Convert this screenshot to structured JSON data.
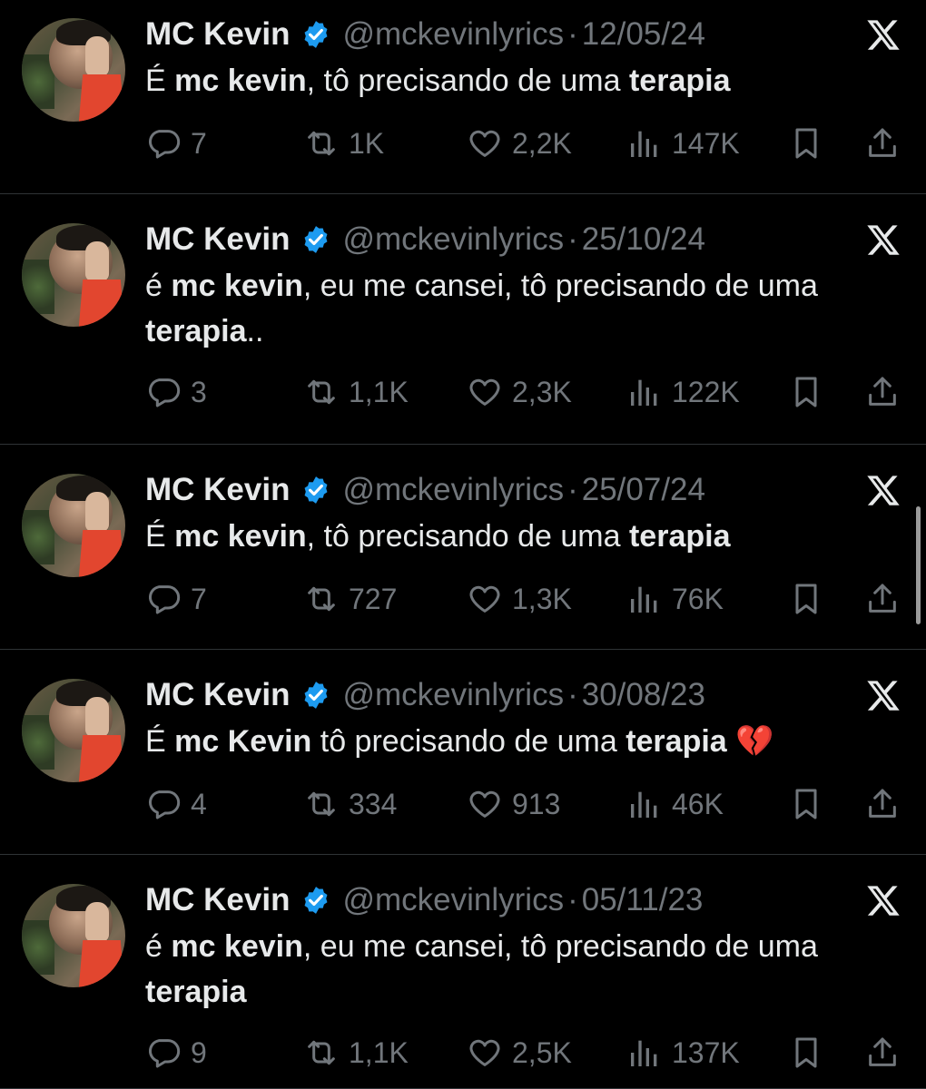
{
  "colors": {
    "background": "#000000",
    "text": "#e7e9ea",
    "muted": "#71767b",
    "verified": "#1d9bf0",
    "divider": "#2f3336"
  },
  "tweets": [
    {
      "name": "MC Kevin",
      "handle": "@mckevinlyrics",
      "separator": "·",
      "date": "12/05/24",
      "text": [
        {
          "t": "É "
        },
        {
          "t": "mc kevin",
          "b": true
        },
        {
          "t": ", tô precisando de uma "
        },
        {
          "t": "terapia",
          "b": true
        }
      ],
      "replies": "7",
      "retweets": "1K",
      "likes": "2,2K",
      "views": "147K"
    },
    {
      "name": "MC Kevin",
      "handle": "@mckevinlyrics",
      "separator": "·",
      "date": "25/10/24",
      "text": [
        {
          "t": "é "
        },
        {
          "t": "mc kevin",
          "b": true
        },
        {
          "t": ", eu me cansei, tô precisando de uma "
        },
        {
          "t": "terapia",
          "b": true
        },
        {
          "t": ".."
        }
      ],
      "replies": "3",
      "retweets": "1,1K",
      "likes": "2,3K",
      "views": "122K"
    },
    {
      "name": "MC Kevin",
      "handle": "@mckevinlyrics",
      "separator": "·",
      "date": "25/07/24",
      "text": [
        {
          "t": "É "
        },
        {
          "t": "mc kevin",
          "b": true
        },
        {
          "t": ", tô precisando de uma "
        },
        {
          "t": "terapia",
          "b": true
        }
      ],
      "replies": "7",
      "retweets": "727",
      "likes": "1,3K",
      "views": "76K"
    },
    {
      "name": "MC Kevin",
      "handle": "@mckevinlyrics",
      "separator": "·",
      "date": "30/08/23",
      "text": [
        {
          "t": "É "
        },
        {
          "t": "mc Kevin",
          "b": true
        },
        {
          "t": " tô precisando de uma "
        },
        {
          "t": "terapia",
          "b": true
        },
        {
          "t": " 💔"
        }
      ],
      "replies": "4",
      "retweets": "334",
      "likes": "913",
      "views": "46K"
    },
    {
      "name": "MC Kevin",
      "handle": "@mckevinlyrics",
      "separator": "·",
      "date": "05/11/23",
      "text": [
        {
          "t": "é "
        },
        {
          "t": "mc kevin",
          "b": true
        },
        {
          "t": ", eu me cansei, tô precisando de uma "
        },
        {
          "t": "terapia",
          "b": true
        }
      ],
      "replies": "9",
      "retweets": "1,1K",
      "likes": "2,5K",
      "views": "137K"
    }
  ],
  "icons": {
    "reply": "reply-icon",
    "retweet": "retweet-icon",
    "like": "like-icon",
    "views": "views-icon",
    "bookmark": "bookmark-icon",
    "share": "share-icon",
    "logo": "x-logo-icon",
    "verified": "verified-badge-icon"
  }
}
